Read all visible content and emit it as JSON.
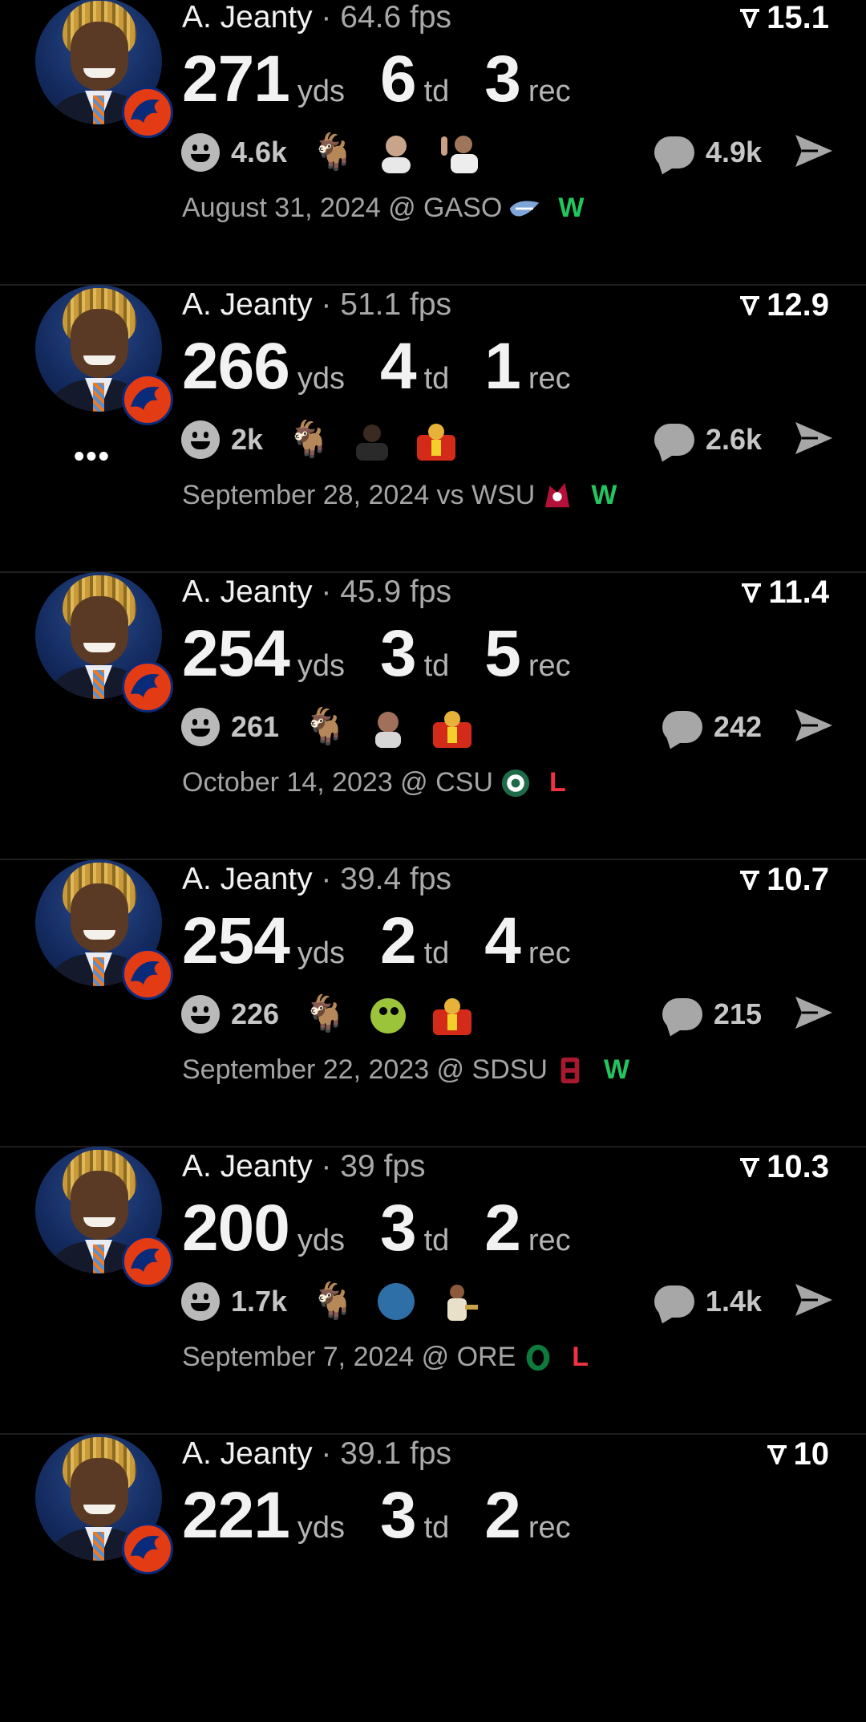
{
  "colors": {
    "background": "#000000",
    "win": "#22c55e",
    "loss": "#ef3340",
    "muted": "#a4a4a4"
  },
  "posts": [
    {
      "player": "A. Jeanty",
      "fps": "64.6 fps",
      "rating": "15.1",
      "stats": [
        {
          "value": "271",
          "unit": "yds"
        },
        {
          "value": "6",
          "unit": "td"
        },
        {
          "value": "3",
          "unit": "rec"
        }
      ],
      "reactions": "4.6k",
      "comments": "4.9k",
      "reaction_emojis": [
        "goat-icon",
        "bald-man-emoji",
        "man-waving-emoji"
      ],
      "date": "August 31, 2024 @ GASO",
      "team_logo": "georgia-southern-logo",
      "team_color": "#7fa6d8",
      "result": "W"
    },
    {
      "player": "A. Jeanty",
      "fps": "51.1 fps",
      "rating": "12.9",
      "stats": [
        {
          "value": "266",
          "unit": "yds"
        },
        {
          "value": "4",
          "unit": "td"
        },
        {
          "value": "1",
          "unit": "rec"
        }
      ],
      "reactions": "2k",
      "comments": "2.6k",
      "reaction_emojis": [
        "goat-icon",
        "man-seated-emoji",
        "fire-man-emoji"
      ],
      "more": "•••",
      "date": "September 28, 2024 vs WSU",
      "team_logo": "wsu-cougar-logo",
      "team_color": "#b3103a",
      "result": "W"
    },
    {
      "player": "A. Jeanty",
      "fps": "45.9 fps",
      "rating": "11.4",
      "stats": [
        {
          "value": "254",
          "unit": "yds"
        },
        {
          "value": "3",
          "unit": "td"
        },
        {
          "value": "5",
          "unit": "rec"
        }
      ],
      "reactions": "261",
      "comments": "242",
      "reaction_emojis": [
        "goat-icon",
        "crying-man-emoji",
        "fire-man-emoji"
      ],
      "date": "October 14, 2023 @ CSU",
      "team_logo": "csu-ram-logo",
      "team_color": "#1e6b4a",
      "result": "L"
    },
    {
      "player": "A. Jeanty",
      "fps": "39.4 fps",
      "rating": "10.7",
      "stats": [
        {
          "value": "254",
          "unit": "yds"
        },
        {
          "value": "2",
          "unit": "td"
        },
        {
          "value": "4",
          "unit": "rec"
        }
      ],
      "reactions": "226",
      "comments": "215",
      "reaction_emojis": [
        "goat-icon",
        "green-orb-emoji",
        "fire-man-emoji"
      ],
      "date": "September 22, 2023 @ SDSU",
      "team_logo": "sdsu-logo",
      "team_color": "#a6192e",
      "result": "W"
    },
    {
      "player": "A. Jeanty",
      "fps": "39 fps",
      "rating": "10.3",
      "stats": [
        {
          "value": "200",
          "unit": "yds"
        },
        {
          "value": "3",
          "unit": "td"
        },
        {
          "value": "2",
          "unit": "rec"
        }
      ],
      "reactions": "1.7k",
      "comments": "1.4k",
      "reaction_emojis": [
        "goat-icon",
        "blue-dot-emoji",
        "player-emoji"
      ],
      "date": "September 7, 2024 @ ORE",
      "team_logo": "oregon-o-logo",
      "team_color": "#0f7a3c",
      "result": "L"
    },
    {
      "player": "A. Jeanty",
      "fps": "39.1 fps",
      "rating": "10",
      "stats": [
        {
          "value": "221",
          "unit": "yds"
        },
        {
          "value": "3",
          "unit": "td"
        },
        {
          "value": "2",
          "unit": "rec"
        }
      ]
    }
  ]
}
